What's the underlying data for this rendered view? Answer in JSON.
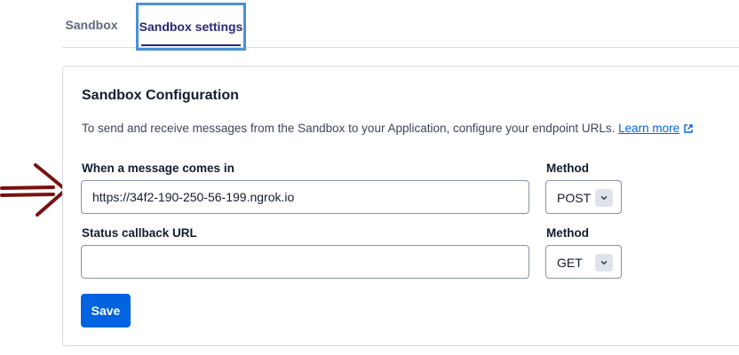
{
  "tabs": [
    {
      "label": "Sandbox",
      "active": false
    },
    {
      "label": "Sandbox settings",
      "active": true
    }
  ],
  "card": {
    "title": "Sandbox Configuration",
    "description": "To send and receive messages from the Sandbox to your Application, configure your endpoint URLs.",
    "learn_more": "Learn more"
  },
  "form": {
    "message_label": "When a message comes in",
    "message_url": "https://34f2-190-250-56-199.ngrok.io",
    "method1_label": "Method",
    "method1_value": "POST",
    "status_label": "Status callback URL",
    "status_url": "",
    "method2_label": "Method",
    "method2_value": "GET",
    "save_label": "Save"
  },
  "icons": {
    "external_link": "external-link-icon",
    "chevron": "chevron-down-icon",
    "annotation_arrow": "arrow-right-icon"
  },
  "colors": {
    "accent": "#0263e0",
    "active_tab": "#27297a",
    "focus_outline": "#4a90d9",
    "annotation": "#7a1010"
  }
}
